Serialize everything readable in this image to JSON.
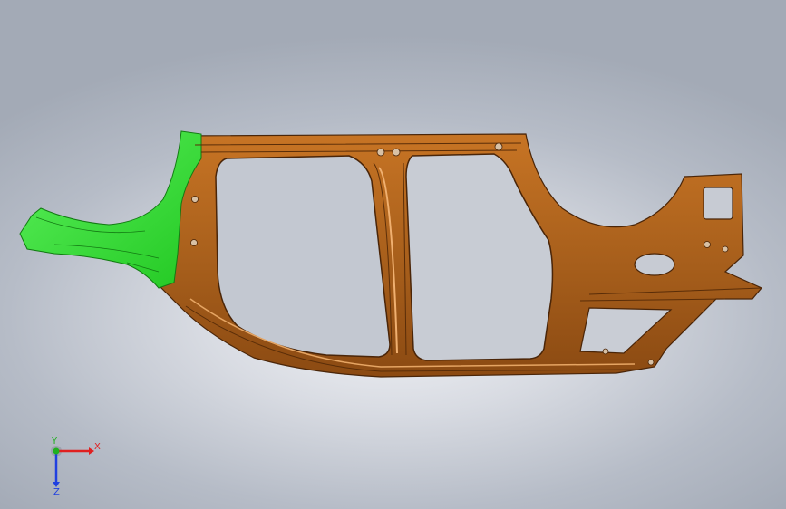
{
  "model": {
    "part_color": "#b8661c",
    "part_dark": "#5a2d08",
    "part_light": "#e0a063",
    "selected_color": "#2fd82f",
    "selected_dark": "#137a13"
  },
  "triad": {
    "x_label": "X",
    "y_label": "Y",
    "z_label": "Z",
    "x_color": "#e02020",
    "y_color": "#20b020",
    "z_color": "#2040e0"
  }
}
